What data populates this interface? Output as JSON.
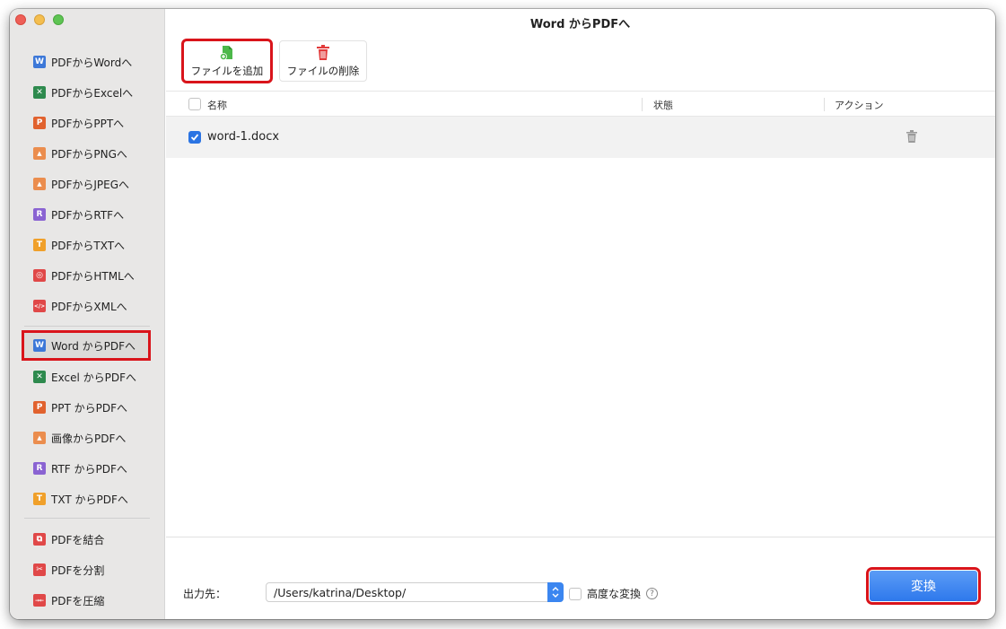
{
  "window": {
    "title": "Word からPDFへ"
  },
  "sidebar": {
    "items": [
      {
        "label": "PDFからWordへ",
        "icon": "word-icon",
        "letter": "W"
      },
      {
        "label": "PDFからExcelへ",
        "icon": "excel-icon",
        "letter": "✕"
      },
      {
        "label": "PDFからPPTへ",
        "icon": "powerpoint-icon",
        "letter": "P"
      },
      {
        "label": "PDFからPNGへ",
        "icon": "image-icon",
        "letter": "▲"
      },
      {
        "label": "PDFからJPEGへ",
        "icon": "image-icon",
        "letter": "▲"
      },
      {
        "label": "PDFからRTFへ",
        "icon": "rtf-icon",
        "letter": "R"
      },
      {
        "label": "PDFからTXTへ",
        "icon": "txt-icon",
        "letter": "T"
      },
      {
        "label": "PDFからHTMLへ",
        "icon": "globe-icon",
        "letter": "◎"
      },
      {
        "label": "PDFからXMLへ",
        "icon": "code-icon",
        "letter": "</>"
      },
      {
        "label": "Word からPDFへ",
        "icon": "word-icon",
        "letter": "W",
        "selected": true
      },
      {
        "label": "Excel からPDFへ",
        "icon": "excel-icon",
        "letter": "✕"
      },
      {
        "label": "PPT からPDFへ",
        "icon": "powerpoint-icon",
        "letter": "P"
      },
      {
        "label": "画像からPDFへ",
        "icon": "image-icon",
        "letter": "▲"
      },
      {
        "label": "RTF からPDFへ",
        "icon": "rtf-icon",
        "letter": "R"
      },
      {
        "label": "TXT からPDFへ",
        "icon": "txt-icon",
        "letter": "T"
      },
      {
        "label": "PDFを結合",
        "icon": "merge-icon",
        "letter": "⧉"
      },
      {
        "label": "PDFを分割",
        "icon": "scissors-icon",
        "letter": "✂"
      },
      {
        "label": "PDFを圧縮",
        "icon": "compress-icon",
        "letter": "→←"
      }
    ]
  },
  "toolbar": {
    "add_label": "ファイルを追加",
    "delete_label": "ファイルの削除"
  },
  "table": {
    "columns": [
      "名称",
      "状態",
      "アクション"
    ],
    "rows": [
      {
        "name": "word-1.docx",
        "checked": true
      }
    ]
  },
  "footer": {
    "output_label": "出力先：",
    "output_path": "/Users/katrina/Desktop/",
    "advanced_label": "高度な変換",
    "help": "?",
    "convert_label": "変換"
  },
  "colors": {
    "accent": "#2e78ec",
    "highlight": "#d9141b"
  }
}
